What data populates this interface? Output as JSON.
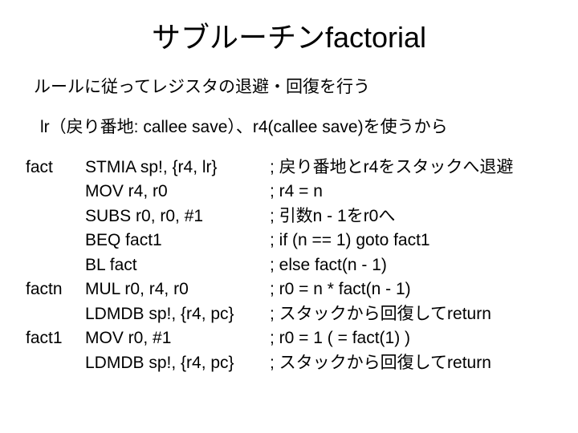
{
  "title": "サブルーチンfactorial",
  "desc1": "ルールに従ってレジスタの退避・回復を行う",
  "desc2": "lr（戻り番地: callee save）、r4(callee save)を使うから",
  "code": [
    {
      "label": "fact",
      "instr": "STMIA  sp!, {r4, lr}",
      "comment": "; 戻り番地とr4をスタックへ退避"
    },
    {
      "label": "",
      "instr": "MOV   r4, r0",
      "comment": "; r4 = n"
    },
    {
      "label": "",
      "instr": "SUBS r0, r0, #1",
      "comment": "; 引数n - 1をr0へ"
    },
    {
      "label": "",
      "instr": "BEQ   fact1",
      "comment": "; if (n == 1) goto fact1"
    },
    {
      "label": "",
      "instr": "BL      fact",
      "comment": "; else fact(n - 1)"
    },
    {
      "label": "factn",
      "instr": "MUL   r0, r4, r0",
      "comment": "; r0 = n * fact(n - 1)"
    },
    {
      "label": "",
      "instr": "LDMDB  sp!, {r4, pc}",
      "comment": "; スタックから回復してreturn"
    },
    {
      "label": "fact1",
      "instr": "MOV   r0, #1",
      "comment": "; r0 = 1 ( = fact(1) )"
    },
    {
      "label": "",
      "instr": "LDMDB  sp!, {r4, pc}",
      "comment": "; スタックから回復してreturn"
    }
  ]
}
